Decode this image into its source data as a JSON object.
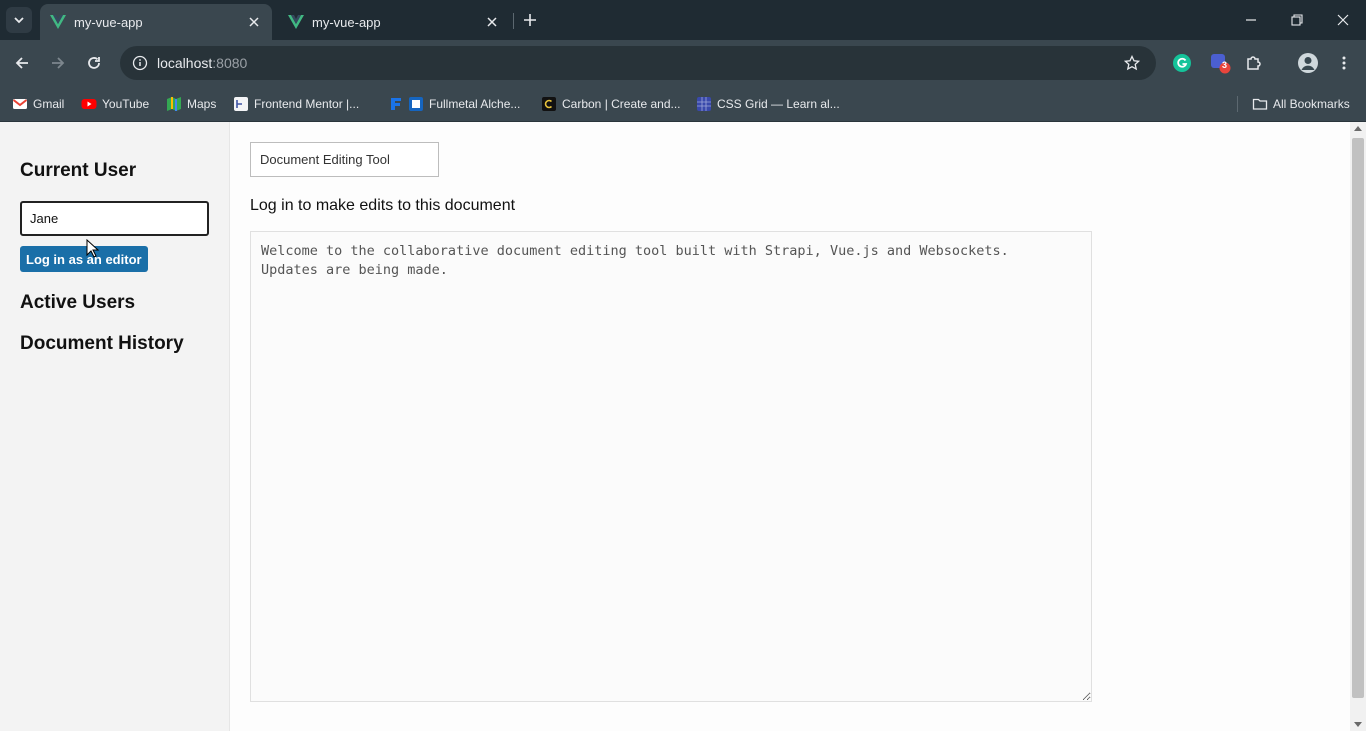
{
  "browser": {
    "tabs": [
      {
        "title": "my-vue-app",
        "active": true
      },
      {
        "title": "my-vue-app",
        "active": false
      }
    ],
    "address": {
      "host": "localhost",
      "port": ":8080"
    },
    "bookmarks": [
      {
        "label": "Gmail",
        "icon": "gmail-icon"
      },
      {
        "label": "YouTube",
        "icon": "youtube-icon"
      },
      {
        "label": "Maps",
        "icon": "maps-icon"
      },
      {
        "label": "Frontend Mentor |...",
        "icon": "frontend-mentor-icon"
      },
      {
        "label": "Fullmetal Alche...",
        "icon": "fullmetal-icon"
      },
      {
        "label": "Carbon | Create and...",
        "icon": "carbon-icon"
      },
      {
        "label": "CSS Grid — Learn al...",
        "icon": "css-grid-icon"
      }
    ],
    "all_bookmarks": "All Bookmarks",
    "extension_badge": "3",
    "colors": {
      "chrome_dark": "#1f2b33",
      "chrome": "#3a474f",
      "vue_green": "#41b883"
    }
  },
  "sidebar": {
    "current_user_heading": "Current User",
    "username_value": "Jane",
    "login_button": "Log in as an editor",
    "active_users_heading": "Active Users",
    "document_history_heading": "Document History"
  },
  "main": {
    "title_value": "Document Editing Tool",
    "notice": "Log in to make edits to this document",
    "content": "Welcome to the collaborative document editing tool built with Strapi, Vue.js and Websockets.\nUpdates are being made.",
    "colors": {
      "button": "#1a6fa8"
    }
  }
}
